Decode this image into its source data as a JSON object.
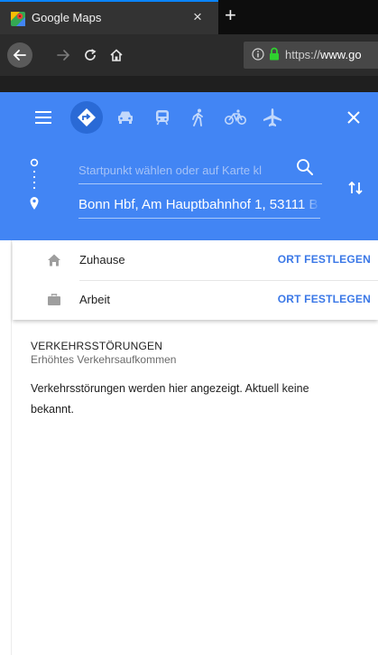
{
  "browser": {
    "tab_title": "Google Maps",
    "close_tab_glyph": "×",
    "new_tab_glyph": "+",
    "url_protocol": "https://",
    "url_host": "www.go"
  },
  "directions": {
    "modes": [
      "best-route",
      "driving",
      "transit",
      "walking",
      "cycling",
      "flights"
    ],
    "active_mode": "best-route",
    "start_placeholder": "Startpunkt wählen oder auf Karte kl",
    "destination_value": "Bonn Hbf, Am Hauptbahnhof 1, 53111 B"
  },
  "places": [
    {
      "label": "Zuhause",
      "action": "ORT FESTLEGEN",
      "icon": "home-icon"
    },
    {
      "label": "Arbeit",
      "action": "ORT FESTLEGEN",
      "icon": "briefcase-icon"
    }
  ],
  "traffic": {
    "title": "VERKEHRSSTÖRUNGEN",
    "subtitle": "Erhöhtes Verkehrsaufkommen",
    "body": "Verkehrsstörungen werden hier angezeigt. Aktuell keine bekannt."
  },
  "colors": {
    "maps_blue": "#4285f4",
    "active_mode_bg": "#2a6ad6",
    "link_blue": "#3b78e7",
    "tab_accent": "#0a84ff",
    "lock_green": "#2fd02f"
  }
}
